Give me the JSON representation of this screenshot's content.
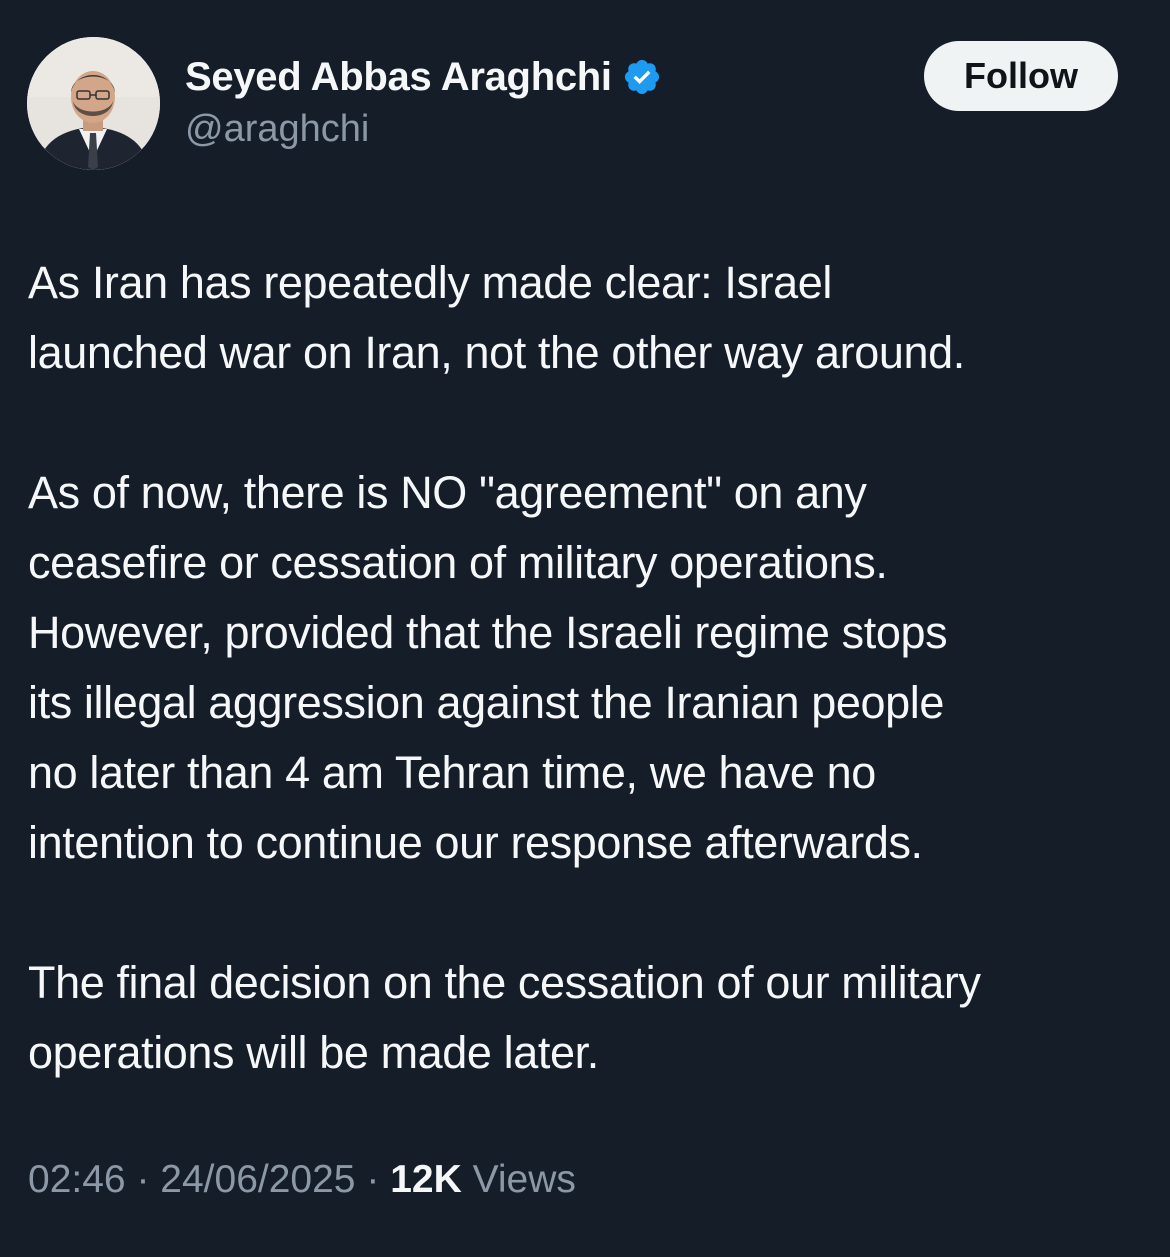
{
  "author": {
    "display_name": "Seyed Abbas Araghchi",
    "handle": "@araghchi",
    "verified": true,
    "avatar_icon": "profile-photo"
  },
  "actions": {
    "follow_label": "Follow"
  },
  "tweet": {
    "paragraphs": [
      [
        "As Iran has repeatedly made clear: Israel",
        "launched war on Iran, not the other way around."
      ],
      [
        "As of now, there is NO \"agreement\" on any",
        "ceasefire or cessation of military operations.",
        "However, provided that the Israeli regime stops",
        "its illegal aggression against the Iranian people",
        "no later than 4 am Tehran time, we have no",
        "intention to continue our response afterwards."
      ],
      [
        "The final decision on the cessation of our military",
        "operations will be made later."
      ]
    ]
  },
  "meta": {
    "time": "02:46",
    "separator": "·",
    "date": "24/06/2025",
    "views_count": "12K",
    "views_label": "Views"
  },
  "colors": {
    "background": "#151d29",
    "primary_text": "#f5f7f9",
    "secondary_text": "#8b98a5",
    "verified_blue": "#1d9bf0",
    "follow_bg": "#eff3f4"
  }
}
